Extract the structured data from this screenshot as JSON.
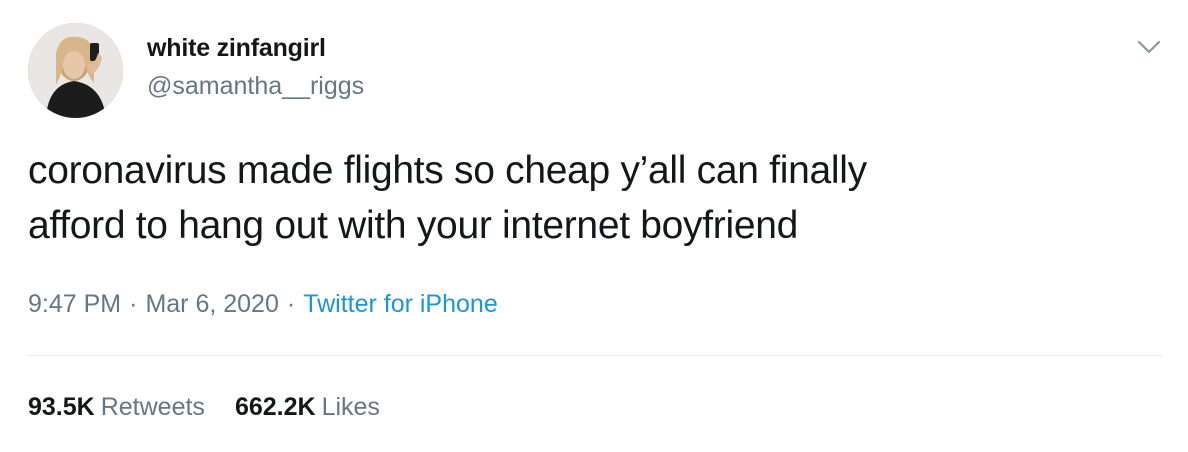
{
  "user": {
    "display_name": "white zinfangirl",
    "handle": "@samantha__riggs",
    "avatar_icon": "profile-photo"
  },
  "tweet": {
    "text_line1": "coronavirus made flights so cheap y’all can finally",
    "text_line2": "afford to hang out with your internet boyfriend",
    "time": "9:47 PM",
    "date": "Mar 6, 2020",
    "separator": "·",
    "source": "Twitter for iPhone"
  },
  "stats": {
    "retweets_count": "93.5K",
    "retweets_label": "Retweets",
    "likes_count": "662.2K",
    "likes_label": "Likes"
  },
  "colors": {
    "text": "#14171a",
    "muted": "#657786",
    "link": "#1b95e0",
    "divider": "#e6ecf0"
  },
  "icons": {
    "menu": "chevron-down-icon"
  }
}
